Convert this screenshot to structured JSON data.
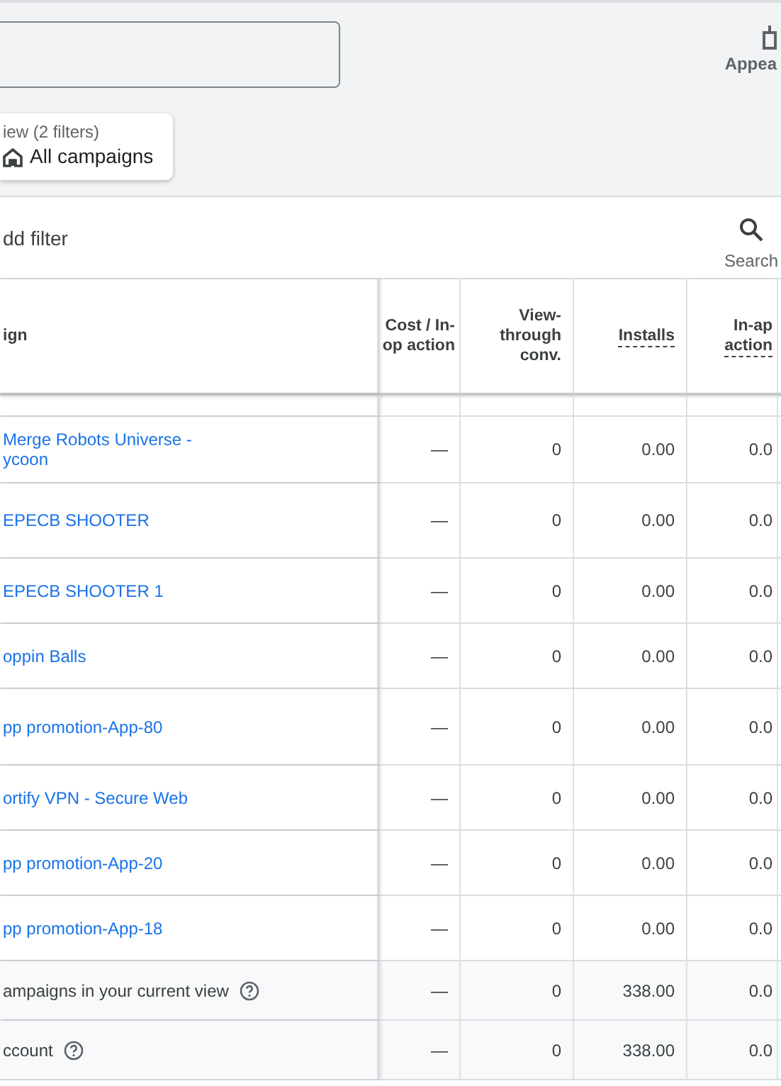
{
  "toolbar": {
    "appearance_label": "Appea"
  },
  "view_chip": {
    "caption": "iew (2 filters)",
    "title": "All campaigns"
  },
  "filter_bar": {
    "add_filter": "dd filter",
    "search": "Search"
  },
  "table": {
    "columns": [
      {
        "label": "ign",
        "underlined": false
      },
      {
        "label": "Cost / In-\nop action",
        "underlined": false
      },
      {
        "label": "View-\nthrough\nconv.",
        "underlined": false
      },
      {
        "label": "Installs",
        "underlined": true
      },
      {
        "label": "In-ap\naction",
        "underlined": true
      }
    ],
    "rows": [
      {
        "cells": [
          "Merge Robots Universe -\nycoon",
          "—",
          "0",
          "0.00",
          "0.0"
        ]
      },
      {
        "cells": [
          "EPECB SHOOTER",
          "—",
          "0",
          "0.00",
          "0.0"
        ]
      },
      {
        "cells": [
          "EPECB SHOOTER 1",
          "—",
          "0",
          "0.00",
          "0.0"
        ]
      },
      {
        "cells": [
          "oppin Balls",
          "—",
          "0",
          "0.00",
          "0.0"
        ]
      },
      {
        "cells": [
          "pp promotion-App-80",
          "—",
          "0",
          "0.00",
          "0.0"
        ]
      },
      {
        "cells": [
          "ortify VPN - Secure Web",
          "—",
          "0",
          "0.00",
          "0.0"
        ]
      },
      {
        "cells": [
          "pp promotion-App-20",
          "—",
          "0",
          "0.00",
          "0.0"
        ]
      },
      {
        "cells": [
          "pp promotion-App-18",
          "—",
          "0",
          "0.00",
          "0.0"
        ]
      }
    ],
    "totals": [
      {
        "cells": [
          "ampaigns in your current view",
          "—",
          "0",
          "338.00",
          "0.0"
        ]
      },
      {
        "cells": [
          "ccount",
          "—",
          "0",
          "338.00",
          "0.0"
        ]
      }
    ]
  }
}
